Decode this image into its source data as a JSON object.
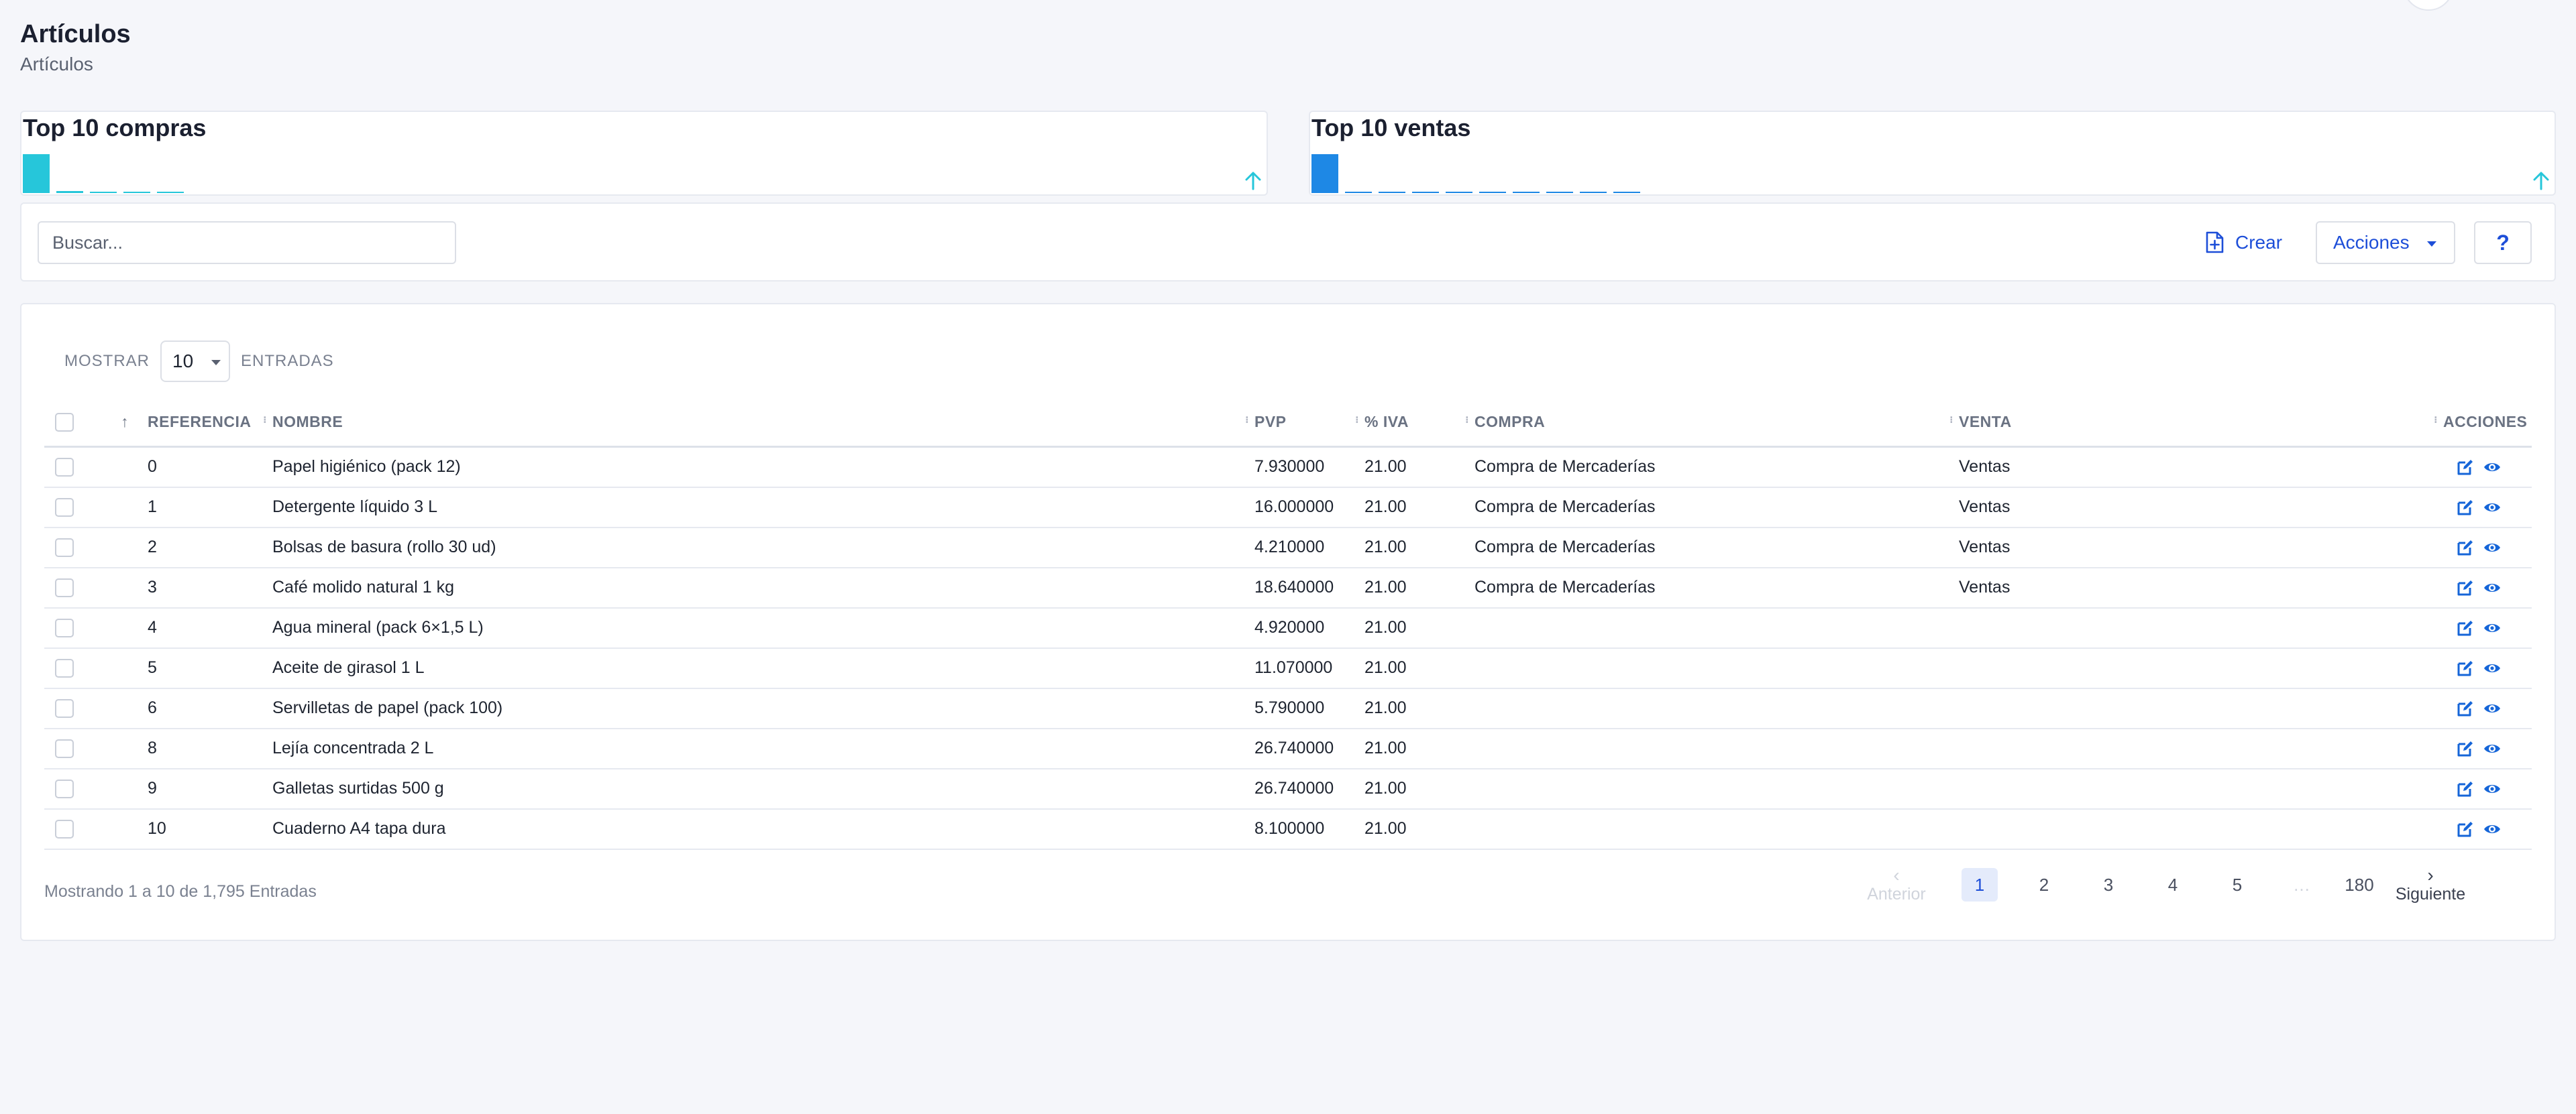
{
  "page": {
    "title": "Artículos",
    "breadcrumb": "Artículos"
  },
  "widgets": {
    "compras": {
      "title": "Top 10 compras",
      "color": "#26c6da",
      "bars": [
        1.0,
        0.06,
        0.02,
        0.02,
        0.02
      ]
    },
    "ventas": {
      "title": "Top 10 ventas",
      "color": "#1e88e5",
      "bars": [
        1.0,
        0.03,
        0.03,
        0.03,
        0.03,
        0.03,
        0.03,
        0.03,
        0.03,
        0.03
      ]
    }
  },
  "toolbar": {
    "search_placeholder": "Buscar...",
    "create_label": "Crear",
    "actions_label": "Acciones",
    "help_label": "?"
  },
  "table": {
    "length_prefix": "MOSTRAR",
    "length_value": "10",
    "length_suffix": "ENTRADAS",
    "columns": {
      "sort": "↑",
      "referencia": "REFERENCIA",
      "nombre": "NOMBRE",
      "pvp": "PVP",
      "iva": "% IVA",
      "compra": "COMPRA",
      "venta": "VENTA",
      "acciones": "ACCIONES"
    },
    "rows": [
      {
        "ref": "0",
        "nombre": "Papel higiénico (pack 12)",
        "pvp": "7.930000",
        "iva": "21.00",
        "compra": "Compra de Mercaderías",
        "venta": "Ventas"
      },
      {
        "ref": "1",
        "nombre": "Detergente líquido 3 L",
        "pvp": "16.000000",
        "iva": "21.00",
        "compra": "Compra de Mercaderías",
        "venta": "Ventas"
      },
      {
        "ref": "2",
        "nombre": "Bolsas de basura (rollo 30 ud)",
        "pvp": "4.210000",
        "iva": "21.00",
        "compra": "Compra de Mercaderías",
        "venta": "Ventas"
      },
      {
        "ref": "3",
        "nombre": "Café molido natural 1 kg",
        "pvp": "18.640000",
        "iva": "21.00",
        "compra": "Compra de Mercaderías",
        "venta": "Ventas"
      },
      {
        "ref": "4",
        "nombre": "Agua mineral (pack 6×1,5 L)",
        "pvp": "4.920000",
        "iva": "21.00",
        "compra": "",
        "venta": ""
      },
      {
        "ref": "5",
        "nombre": "Aceite de girasol 1 L",
        "pvp": "11.070000",
        "iva": "21.00",
        "compra": "",
        "venta": ""
      },
      {
        "ref": "6",
        "nombre": "Servilletas de papel (pack 100)",
        "pvp": "5.790000",
        "iva": "21.00",
        "compra": "",
        "venta": ""
      },
      {
        "ref": "8",
        "nombre": "Lejía concentrada 2 L",
        "pvp": "26.740000",
        "iva": "21.00",
        "compra": "",
        "venta": ""
      },
      {
        "ref": "9",
        "nombre": "Galletas surtidas 500 g",
        "pvp": "26.740000",
        "iva": "21.00",
        "compra": "",
        "venta": ""
      },
      {
        "ref": "10",
        "nombre": "Cuaderno A4 tapa dura",
        "pvp": "8.100000",
        "iva": "21.00",
        "compra": "",
        "venta": ""
      }
    ],
    "info": "Mostrando 1 a 10 de 1,795 Entradas"
  },
  "pagination": {
    "prev_label": "Anterior",
    "next_label": "Siguiente",
    "pages": [
      "1",
      "2",
      "3",
      "4",
      "5"
    ],
    "ellipsis": "…",
    "last": "180",
    "active": "1"
  },
  "colors": {
    "accent": "#1d4ed8",
    "icon": "#1565d8"
  }
}
